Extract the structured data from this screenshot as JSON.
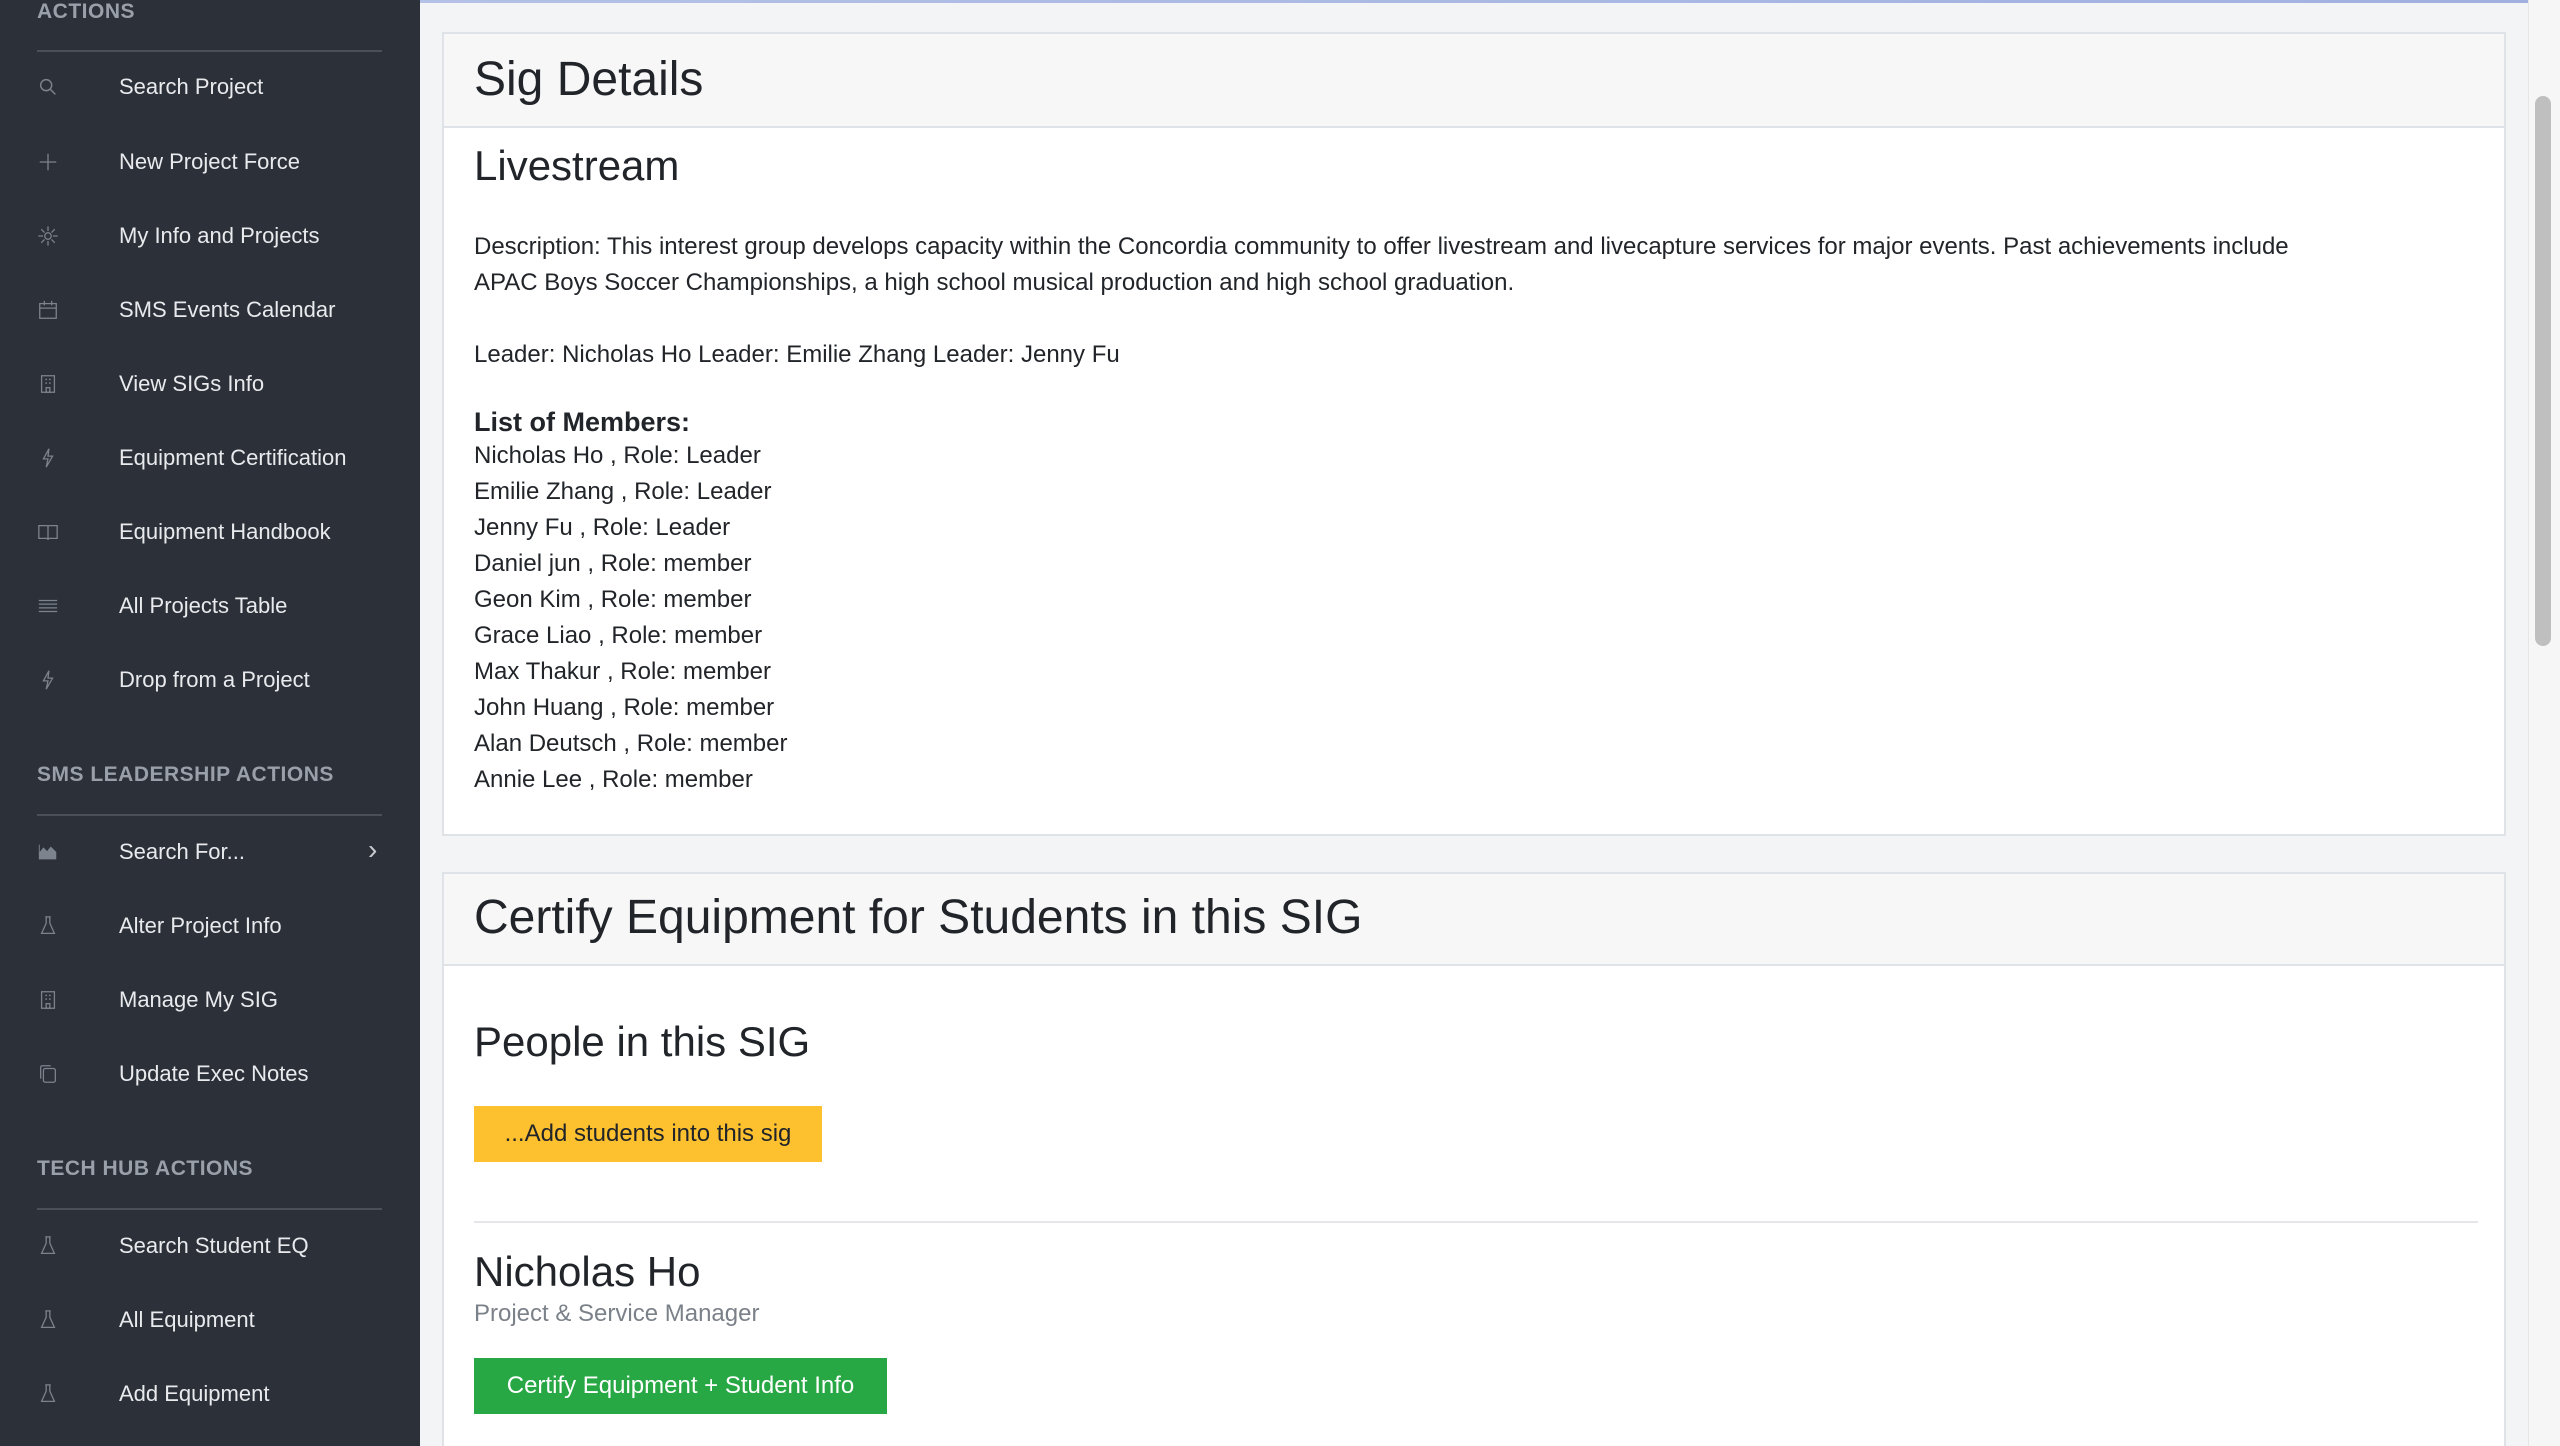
{
  "sidebar": {
    "sections": [
      {
        "title": "ACTIONS",
        "items": [
          {
            "label": "Search Project",
            "icon": "search-icon"
          },
          {
            "label": "New Project Force",
            "icon": "plus-icon"
          },
          {
            "label": "My Info and Projects",
            "icon": "gear-icon"
          },
          {
            "label": "SMS Events Calendar",
            "icon": "calendar-icon"
          },
          {
            "label": "View SIGs Info",
            "icon": "building-icon"
          },
          {
            "label": "Equipment Certification",
            "icon": "bolt-icon"
          },
          {
            "label": "Equipment Handbook",
            "icon": "book-icon"
          },
          {
            "label": "All Projects Table",
            "icon": "list-icon"
          },
          {
            "label": "Drop from a Project",
            "icon": "bolt-icon"
          }
        ]
      },
      {
        "title": "SMS LEADERSHIP ACTIONS",
        "items": [
          {
            "label": "Search For...",
            "icon": "area-chart-icon"
          },
          {
            "label": "Alter Project Info",
            "icon": "flask-icon"
          },
          {
            "label": "Manage My SIG",
            "icon": "building-icon"
          },
          {
            "label": "Update Exec Notes",
            "icon": "copy-icon"
          }
        ]
      },
      {
        "title": "TECH HUB ACTIONS",
        "items": [
          {
            "label": "Search Student EQ",
            "icon": "flask-icon"
          },
          {
            "label": "All Equipment",
            "icon": "flask-icon"
          },
          {
            "label": "Add Equipment",
            "icon": "flask-icon"
          }
        ]
      }
    ]
  },
  "sig_card": {
    "header": "Sig Details",
    "name": "Livestream",
    "description_line1": "Description: This interest group develops capacity within the Concordia community to offer livestream and livecapture services for major events. Past achievements include",
    "description_line2": "APAC Boys Soccer Championships, a high school musical production and high school graduation.",
    "leaders": "Leader: Nicholas Ho Leader: Emilie Zhang Leader: Jenny Fu",
    "members_title": "List of Members:",
    "members": [
      "Nicholas Ho , Role: Leader",
      "Emilie Zhang , Role: Leader",
      "Jenny Fu , Role: Leader",
      "Daniel jun , Role: member",
      "Geon Kim , Role: member",
      "Grace Liao , Role: member",
      "Max Thakur , Role: member",
      "John Huang , Role: member",
      "Alan Deutsch , Role: member",
      "Annie Lee , Role: member"
    ]
  },
  "certify_card": {
    "header": "Certify Equipment for Students in this SIG",
    "people_title": "People in this SIG",
    "add_button": "...Add students into this sig",
    "person_name": "Nicholas Ho",
    "person_role": "Project & Service Manager",
    "certify_button": "Certify Equipment + Student Info"
  },
  "colors": {
    "sidebar_bg": "#2c3038",
    "yellow_button": "#fdc02f",
    "green_button": "#28a745"
  }
}
